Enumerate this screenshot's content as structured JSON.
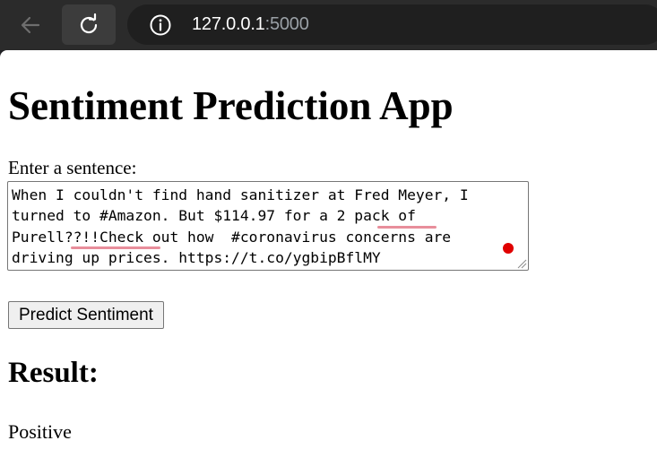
{
  "browser": {
    "url_host": "127.0.0.1",
    "url_port": ":5000",
    "chrome_color": "#2b2b2b",
    "address_bar_color": "#1f1f1f"
  },
  "page": {
    "title": "Sentiment Prediction App",
    "input_label": "Enter a sentence:",
    "input_lines": [
      "When I couldn't find hand sanitizer at Fred Meyer, I",
      "turned to #Amazon. But $114.97 for a 2 pack of",
      "Purell??!!Check out how  #coronavirus concerns are",
      "driving up prices. https://t.co/ygbipBflMY"
    ],
    "predict_button": "Predict Sentiment",
    "result_heading": "Result:",
    "result_value": "Positive"
  },
  "icons": [
    "back-arrow-icon",
    "reload-icon",
    "info-icon",
    "resize-handle-icon"
  ],
  "colors": {
    "spellcheck_underline": "#e88e9b",
    "cursor_dot": "#e00000"
  }
}
